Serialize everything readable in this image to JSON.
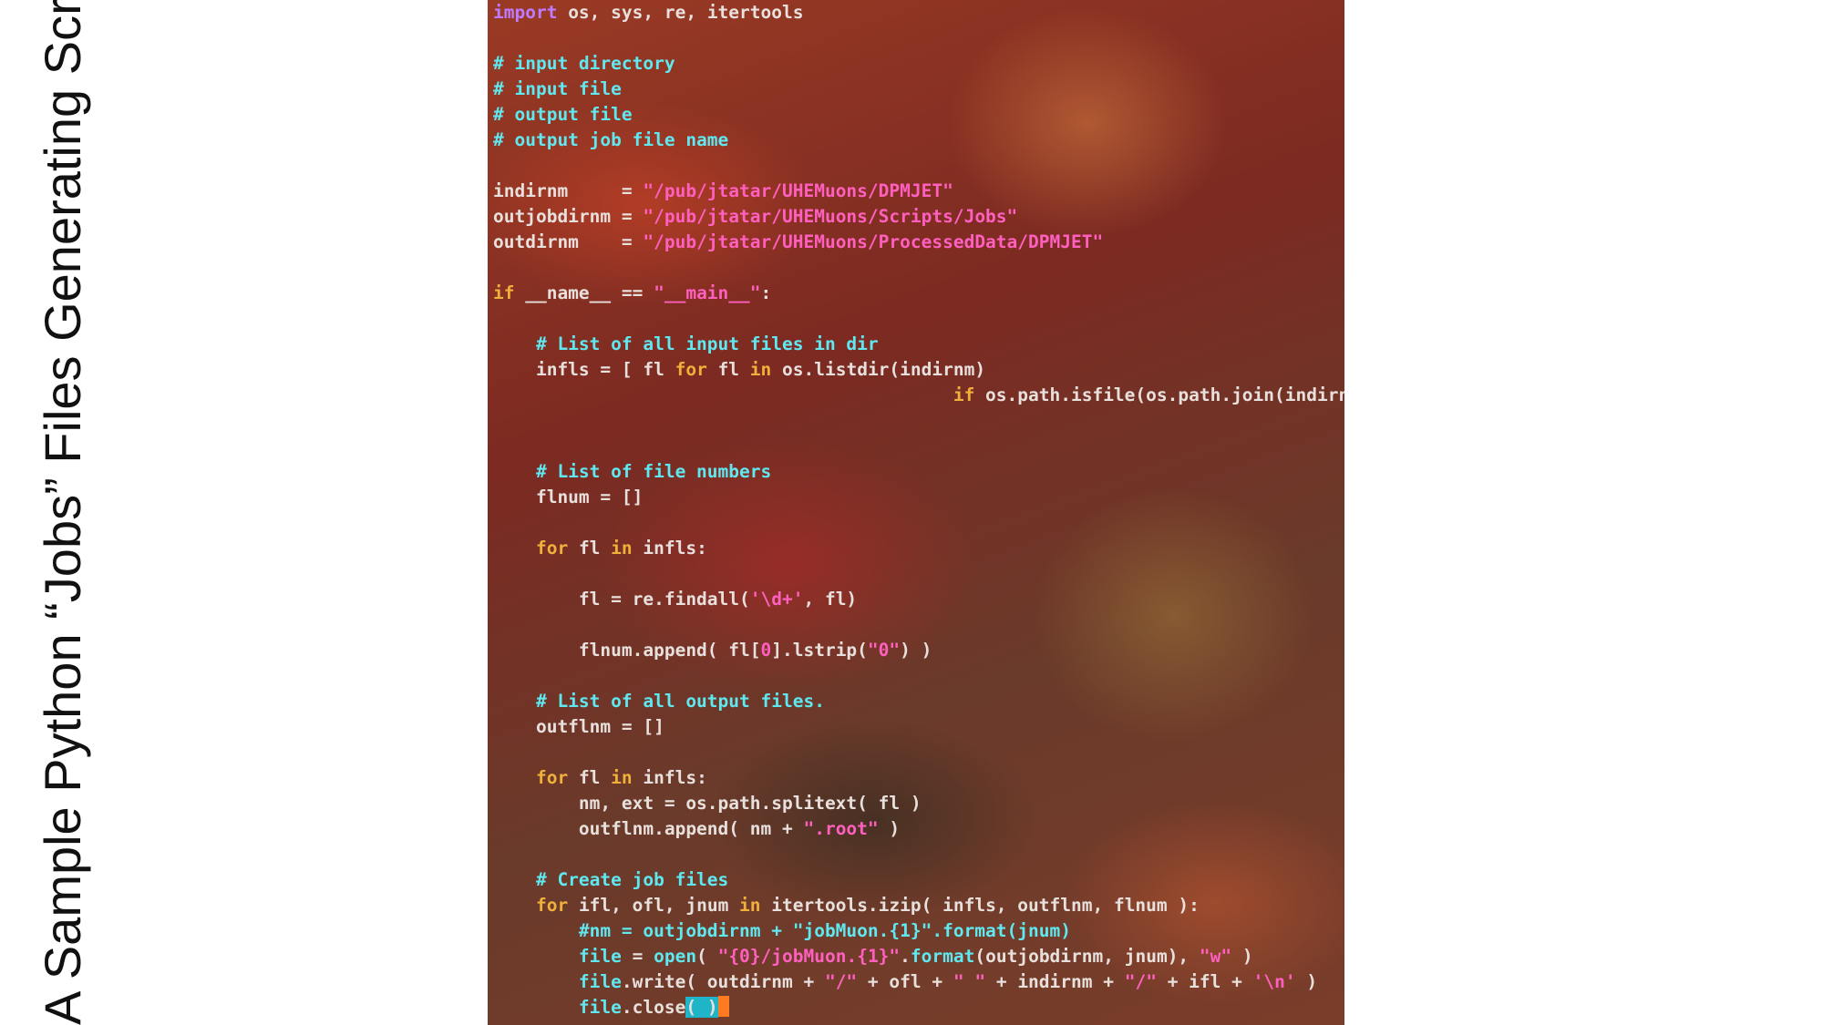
{
  "slide": {
    "title": "A Sample Python “Jobs” Files Generating Script"
  },
  "code": {
    "import_kw": "import",
    "import_rest": " os, sys, re, itertools",
    "c_input_dir": "# input directory",
    "c_input_file": "# input file",
    "c_output_file": "# output file",
    "c_output_job": "# output job file name",
    "indirnm_lhs": "indirnm     = ",
    "indirnm_val": "\"/pub/jtatar/UHEMuons/DPMJET\"",
    "outjob_lhs": "outjobdirnm = ",
    "outjob_val": "\"/pub/jtatar/UHEMuons/Scripts/Jobs\"",
    "outdir_lhs": "outdirnm    = ",
    "outdir_val": "\"/pub/jtatar/UHEMuons/ProcessedData/DPMJET\"",
    "if_kw": "if",
    "if_mid": " __name__ == ",
    "if_str": "\"__main__\"",
    "if_end": ":",
    "c_list_inputs": "    # List of all input files in dir",
    "infls_a": "    infls = [ fl ",
    "for_kw": "for",
    "infls_b": " fl ",
    "in_kw": "in",
    "infls_c": " os.listdir(indirnm)",
    "infls2_pad": "                                           ",
    "infls2_rest": " os.path.isfile(os.path.join(indirnm, fl)) ]",
    "c_file_numbers": "    # List of file numbers",
    "flnum_decl": "    flnum = []",
    "for_infls_rest": " infls:",
    "re_a": "        fl = re.findall(",
    "re_str": "'\\d+'",
    "re_b": ", fl)",
    "app_a": "        flnum.append( fl[",
    "app_idx": "0",
    "app_b": "].lstrip(",
    "app_str": "\"0\"",
    "app_c": ") )",
    "c_list_outputs": "    # List of all output files.",
    "outflnm_decl": "    outflnm = []",
    "split_line": "        nm, ext = os.path.splitext( fl )",
    "oapp_a": "        outflnm.append( nm + ",
    "oapp_str": "\".root\"",
    "oapp_b": " )",
    "c_create_jobs": "    # Create job files",
    "izip_a": " ifl, ofl, jnum ",
    "izip_b": " itertools.izip( infls, outflnm, flnum ):",
    "c_nm_line": "        #nm = outjobdirnm + \"jobMuon.{1}\".format(jnum)",
    "file_kw": "file",
    "open_a": " = ",
    "open_kw": "open",
    "open_b": "( ",
    "open_str": "\"{0}/jobMuon.{1}\"",
    "open_c": ".",
    "format_kw": "format",
    "open_d": "(outjobdirnm, jnum), ",
    "open_w": "\"w\"",
    "open_e": " )",
    "write_a": ".write( outdirnm + ",
    "slash": "\"/\"",
    "write_b": " + ofl + ",
    "space_str": "\" \"",
    "write_c": " + indirnm + ",
    "write_d": " + ifl + ",
    "newline_str": "'\\n'",
    "write_e": " )",
    "close_a": ".close",
    "close_paren": "(",
    "close_hl": " )",
    "indent4": "    ",
    "indent8": "        "
  }
}
